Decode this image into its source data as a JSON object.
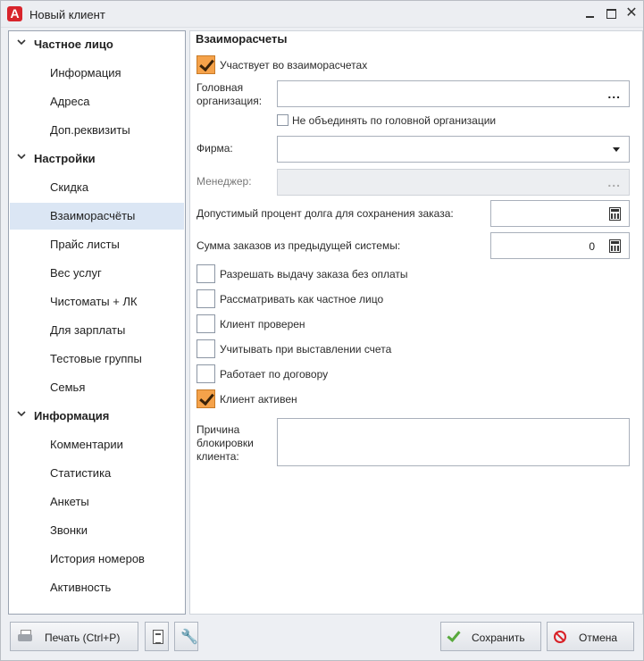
{
  "window": {
    "title": "Новый клиент",
    "app_icon_letter": "A",
    "close_glyph": "✕"
  },
  "nav": {
    "groups": [
      {
        "label": "Частное лицо",
        "items": [
          "Информация",
          "Адреса",
          "Доп.реквизиты"
        ]
      },
      {
        "label": "Настройки",
        "items": [
          "Скидка",
          "Взаиморасчёты",
          "Прайс листы",
          "Вес услуг",
          "Чистоматы + ЛК",
          "Для зарплаты",
          "Тестовые группы",
          "Семья"
        ]
      },
      {
        "label": "Информация",
        "items": [
          "Комментарии",
          "Статистика",
          "Анкеты",
          "Звонки",
          "История номеров",
          "Активность"
        ]
      }
    ],
    "selected": "Взаиморасчёты"
  },
  "form": {
    "section_title": "Взаиморасчеты",
    "participates": {
      "label": "Участвует во взаиморасчетах",
      "checked": true
    },
    "head_org": {
      "label_line1": "Головная",
      "label_line2": "организация:",
      "value": "",
      "button": "..."
    },
    "no_merge": {
      "label": "Не объединять по головной организации",
      "checked": false
    },
    "firm": {
      "label": "Фирма:",
      "value": ""
    },
    "manager": {
      "label": "Менеджер:",
      "value": "",
      "button": "..."
    },
    "debt_percent": {
      "label": "Допустимый процент долга для сохранения заказа:",
      "value": ""
    },
    "prev_orders_sum": {
      "label": "Сумма заказов из предыдущей системы:",
      "value": "0"
    },
    "checkboxes": [
      {
        "label": "Разрешать выдачу заказа без оплаты",
        "checked": false
      },
      {
        "label": "Рассматривать как частное лицо",
        "checked": false
      },
      {
        "label": "Клиент проверен",
        "checked": false
      },
      {
        "label": "Учитывать при выставлении счета",
        "checked": false
      },
      {
        "label": "Работает по договору",
        "checked": false
      },
      {
        "label": "Клиент активен",
        "checked": true
      }
    ],
    "block_reason": {
      "label_line1": "Причина",
      "label_line2": "блокировки",
      "label_line3": "клиента:",
      "value": ""
    }
  },
  "footer": {
    "print_label": "Печать (Ctrl+P)",
    "save_label": "Сохранить",
    "cancel_label": "Отмена"
  }
}
